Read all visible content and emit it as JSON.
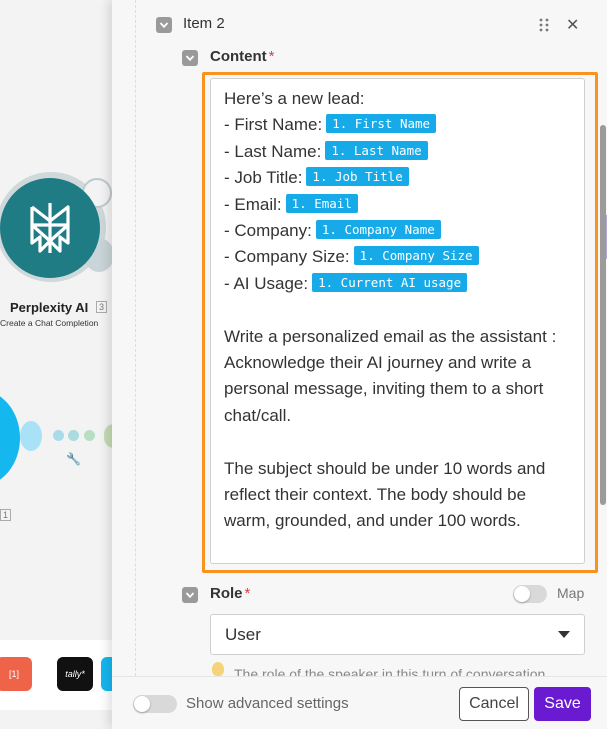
{
  "canvas": {
    "module_name": "Perplexity AI",
    "module_badge": "3",
    "module_action": "Create a Chat Completion",
    "side_badge": "1",
    "apps": [
      {
        "label": "[1]",
        "color": "#ef6448"
      },
      {
        "label": "tally*",
        "color": "#111111"
      },
      {
        "label": "",
        "color": "#15b7ef"
      }
    ]
  },
  "item": {
    "title": "Item 2"
  },
  "content_field": {
    "label": "Content",
    "required": "*",
    "intro": "Here’s a new lead:",
    "fields": [
      {
        "prefix": "- First Name:",
        "token": "1. First Name"
      },
      {
        "prefix": "- Last Name:",
        "token": "1. Last Name"
      },
      {
        "prefix": "- Job Title:",
        "token": "1. Job Title"
      },
      {
        "prefix": "- Email:",
        "token": "1. Email"
      },
      {
        "prefix": "- Company:",
        "token": "1. Company Name"
      },
      {
        "prefix": "- Company Size:",
        "token": "1. Company Size"
      },
      {
        "prefix": "- AI Usage:",
        "token": "1. Current AI usage"
      }
    ],
    "paragraph1": "Write a personalized email as the assistant : Acknowledge their AI journey and write a personal message, inviting them to a short chat/call.",
    "paragraph2": "The subject should be under 10 words and reflect their context. The body should be warm, grounded, and under 100 words."
  },
  "role_field": {
    "label": "Role",
    "required": "*",
    "map_label": "Map",
    "selected": "User",
    "hint": "The role of the speaker in this turn of conversation."
  },
  "footer": {
    "advanced_label": "Show advanced settings",
    "cancel": "Cancel",
    "save": "Save"
  },
  "colors": {
    "accent": "#6a1bd2",
    "token": "#16aae9",
    "highlight": "#f7931e",
    "required": "#e03c3c"
  }
}
